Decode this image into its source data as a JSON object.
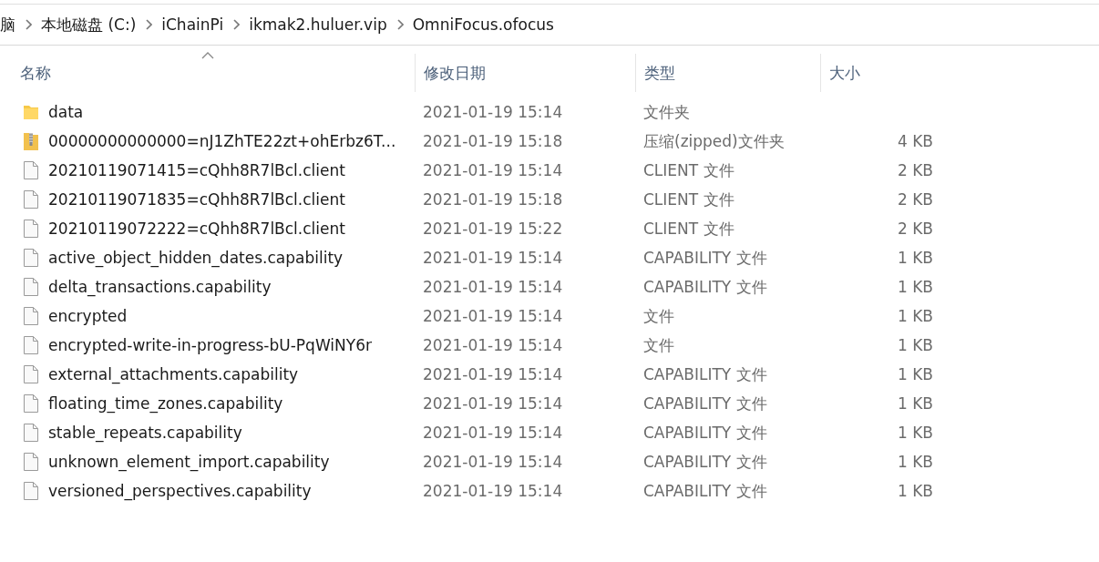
{
  "breadcrumb": [
    "脑",
    "本地磁盘 (C:)",
    "iChainPi",
    "ikmak2.huluer.vip",
    "OmniFocus.ofocus"
  ],
  "table": {
    "columns": [
      {
        "label": "名称",
        "sorted": true
      },
      {
        "label": "修改日期",
        "sorted": false
      },
      {
        "label": "类型",
        "sorted": false
      },
      {
        "label": "大小",
        "sorted": false
      }
    ],
    "rows": [
      {
        "kind": "folder",
        "name": "data",
        "date": "2021-01-19 15:14",
        "type": "文件夹"
      },
      {
        "kind": "zip",
        "name": "00000000000000=nJ1ZhTE22zt+ohErbz6T...",
        "date": "2021-01-19 15:18",
        "type": "压缩(zipped)文件夹",
        "size": "4 KB"
      },
      {
        "kind": "file",
        "name": "20210119071415=cQhh8R7lBcl.client",
        "date": "2021-01-19 15:14",
        "type": "CLIENT 文件",
        "size": "2 KB"
      },
      {
        "kind": "file",
        "name": "20210119071835=cQhh8R7lBcl.client",
        "date": "2021-01-19 15:18",
        "type": "CLIENT 文件",
        "size": "2 KB"
      },
      {
        "kind": "file",
        "name": "20210119072222=cQhh8R7lBcl.client",
        "date": "2021-01-19 15:22",
        "type": "CLIENT 文件",
        "size": "2 KB"
      },
      {
        "kind": "file",
        "name": "active_object_hidden_dates.capability",
        "date": "2021-01-19 15:14",
        "type": "CAPABILITY 文件",
        "size": "1 KB"
      },
      {
        "kind": "file",
        "name": "delta_transactions.capability",
        "date": "2021-01-19 15:14",
        "type": "CAPABILITY 文件",
        "size": "1 KB"
      },
      {
        "kind": "file",
        "name": "encrypted",
        "date": "2021-01-19 15:14",
        "type": "文件",
        "size": "1 KB"
      },
      {
        "kind": "file",
        "name": "encrypted-write-in-progress-bU-PqWiNY6r",
        "date": "2021-01-19 15:14",
        "type": "文件",
        "size": "1 KB"
      },
      {
        "kind": "file",
        "name": "external_attachments.capability",
        "date": "2021-01-19 15:14",
        "type": "CAPABILITY 文件",
        "size": "1 KB"
      },
      {
        "kind": "file",
        "name": "floating_time_zones.capability",
        "date": "2021-01-19 15:14",
        "type": "CAPABILITY 文件",
        "size": "1 KB"
      },
      {
        "kind": "file",
        "name": "stable_repeats.capability",
        "date": "2021-01-19 15:14",
        "type": "CAPABILITY 文件",
        "size": "1 KB"
      },
      {
        "kind": "file",
        "name": "unknown_element_import.capability",
        "date": "2021-01-19 15:14",
        "type": "CAPABILITY 文件",
        "size": "1 KB"
      },
      {
        "kind": "file",
        "name": "versioned_perspectives.capability",
        "date": "2021-01-19 15:14",
        "type": "CAPABILITY 文件",
        "size": "1 KB"
      }
    ]
  }
}
